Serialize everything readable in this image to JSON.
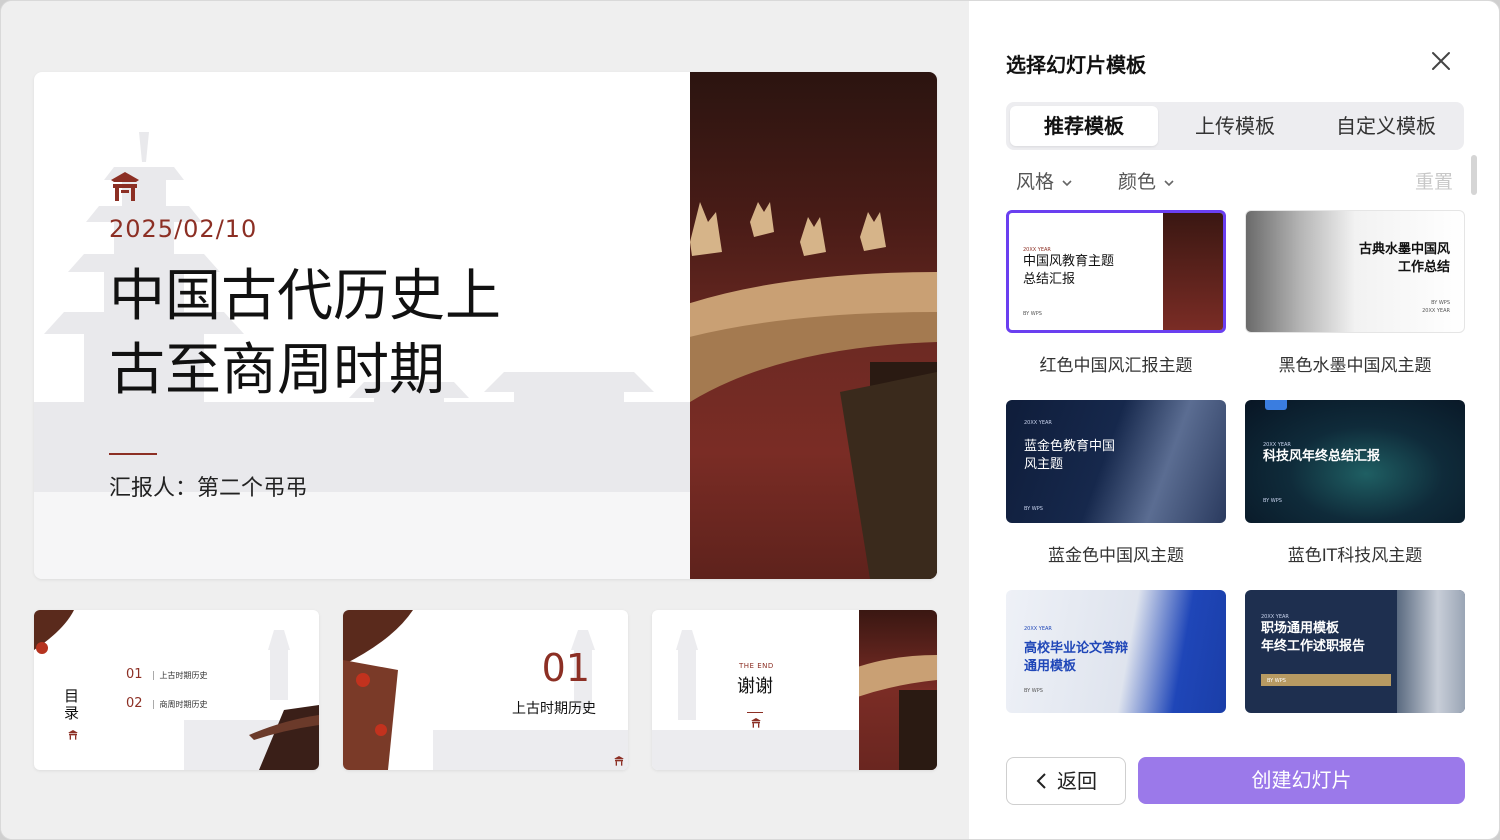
{
  "preview": {
    "main_slide": {
      "date": "2025/02/10",
      "title_line1": "中国古代历史上",
      "title_line2": "古至商周时期",
      "reporter": "汇报人：第二个弔弔"
    },
    "thumbnails": {
      "toc": {
        "heading": "目录",
        "items": [
          {
            "num": "01",
            "label": "上古时期历史"
          },
          {
            "num": "02",
            "label": "商周时期历史"
          }
        ]
      },
      "section": {
        "number": "01",
        "title": "上古时期历史"
      },
      "end": {
        "small": "THE END",
        "title": "谢谢"
      }
    }
  },
  "panel": {
    "title": "选择幻灯片模板",
    "tabs": [
      {
        "label": "推荐模板",
        "active": true
      },
      {
        "label": "上传模板",
        "active": false
      },
      {
        "label": "自定义模板",
        "active": false
      }
    ],
    "filters": {
      "style": "风格",
      "color": "颜色",
      "reset": "重置"
    },
    "templates": [
      {
        "name": "红色中国风汇报主题",
        "thumb_small": "20XX YEAR",
        "thumb_title": "中国风教育主题\n总结汇报",
        "thumb_by": "BY WPS",
        "selected": true
      },
      {
        "name": "黑色水墨中国风主题",
        "thumb_title": "古典水墨中国风\n工作总结",
        "thumb_by": "BY WPS\n20XX YEAR",
        "selected": false
      },
      {
        "name": "蓝金色中国风主题",
        "thumb_small": "20XX YEAR",
        "thumb_title": "蓝金色教育中国\n风主题",
        "thumb_by": "BY WPS",
        "selected": false
      },
      {
        "name": "蓝色IT科技风主题",
        "thumb_small": "20XX YEAR",
        "thumb_title": "科技风年终总结汇报",
        "thumb_by": "BY WPS",
        "selected": false
      },
      {
        "name": "",
        "thumb_small": "20XX YEAR",
        "thumb_title": "高校毕业论文答辩\n通用模板",
        "thumb_by": "BY WPS",
        "selected": false
      },
      {
        "name": "",
        "thumb_small": "20XX YEAR",
        "thumb_title": "职场通用模板\n年终工作述职报告",
        "thumb_by": "BY WPS",
        "selected": false
      }
    ],
    "back_label": "返回",
    "create_label": "创建幻灯片"
  },
  "colors": {
    "accent_red": "#8c2f24",
    "primary_purple": "#9b79ea",
    "selected_border": "#6a3ff0"
  }
}
